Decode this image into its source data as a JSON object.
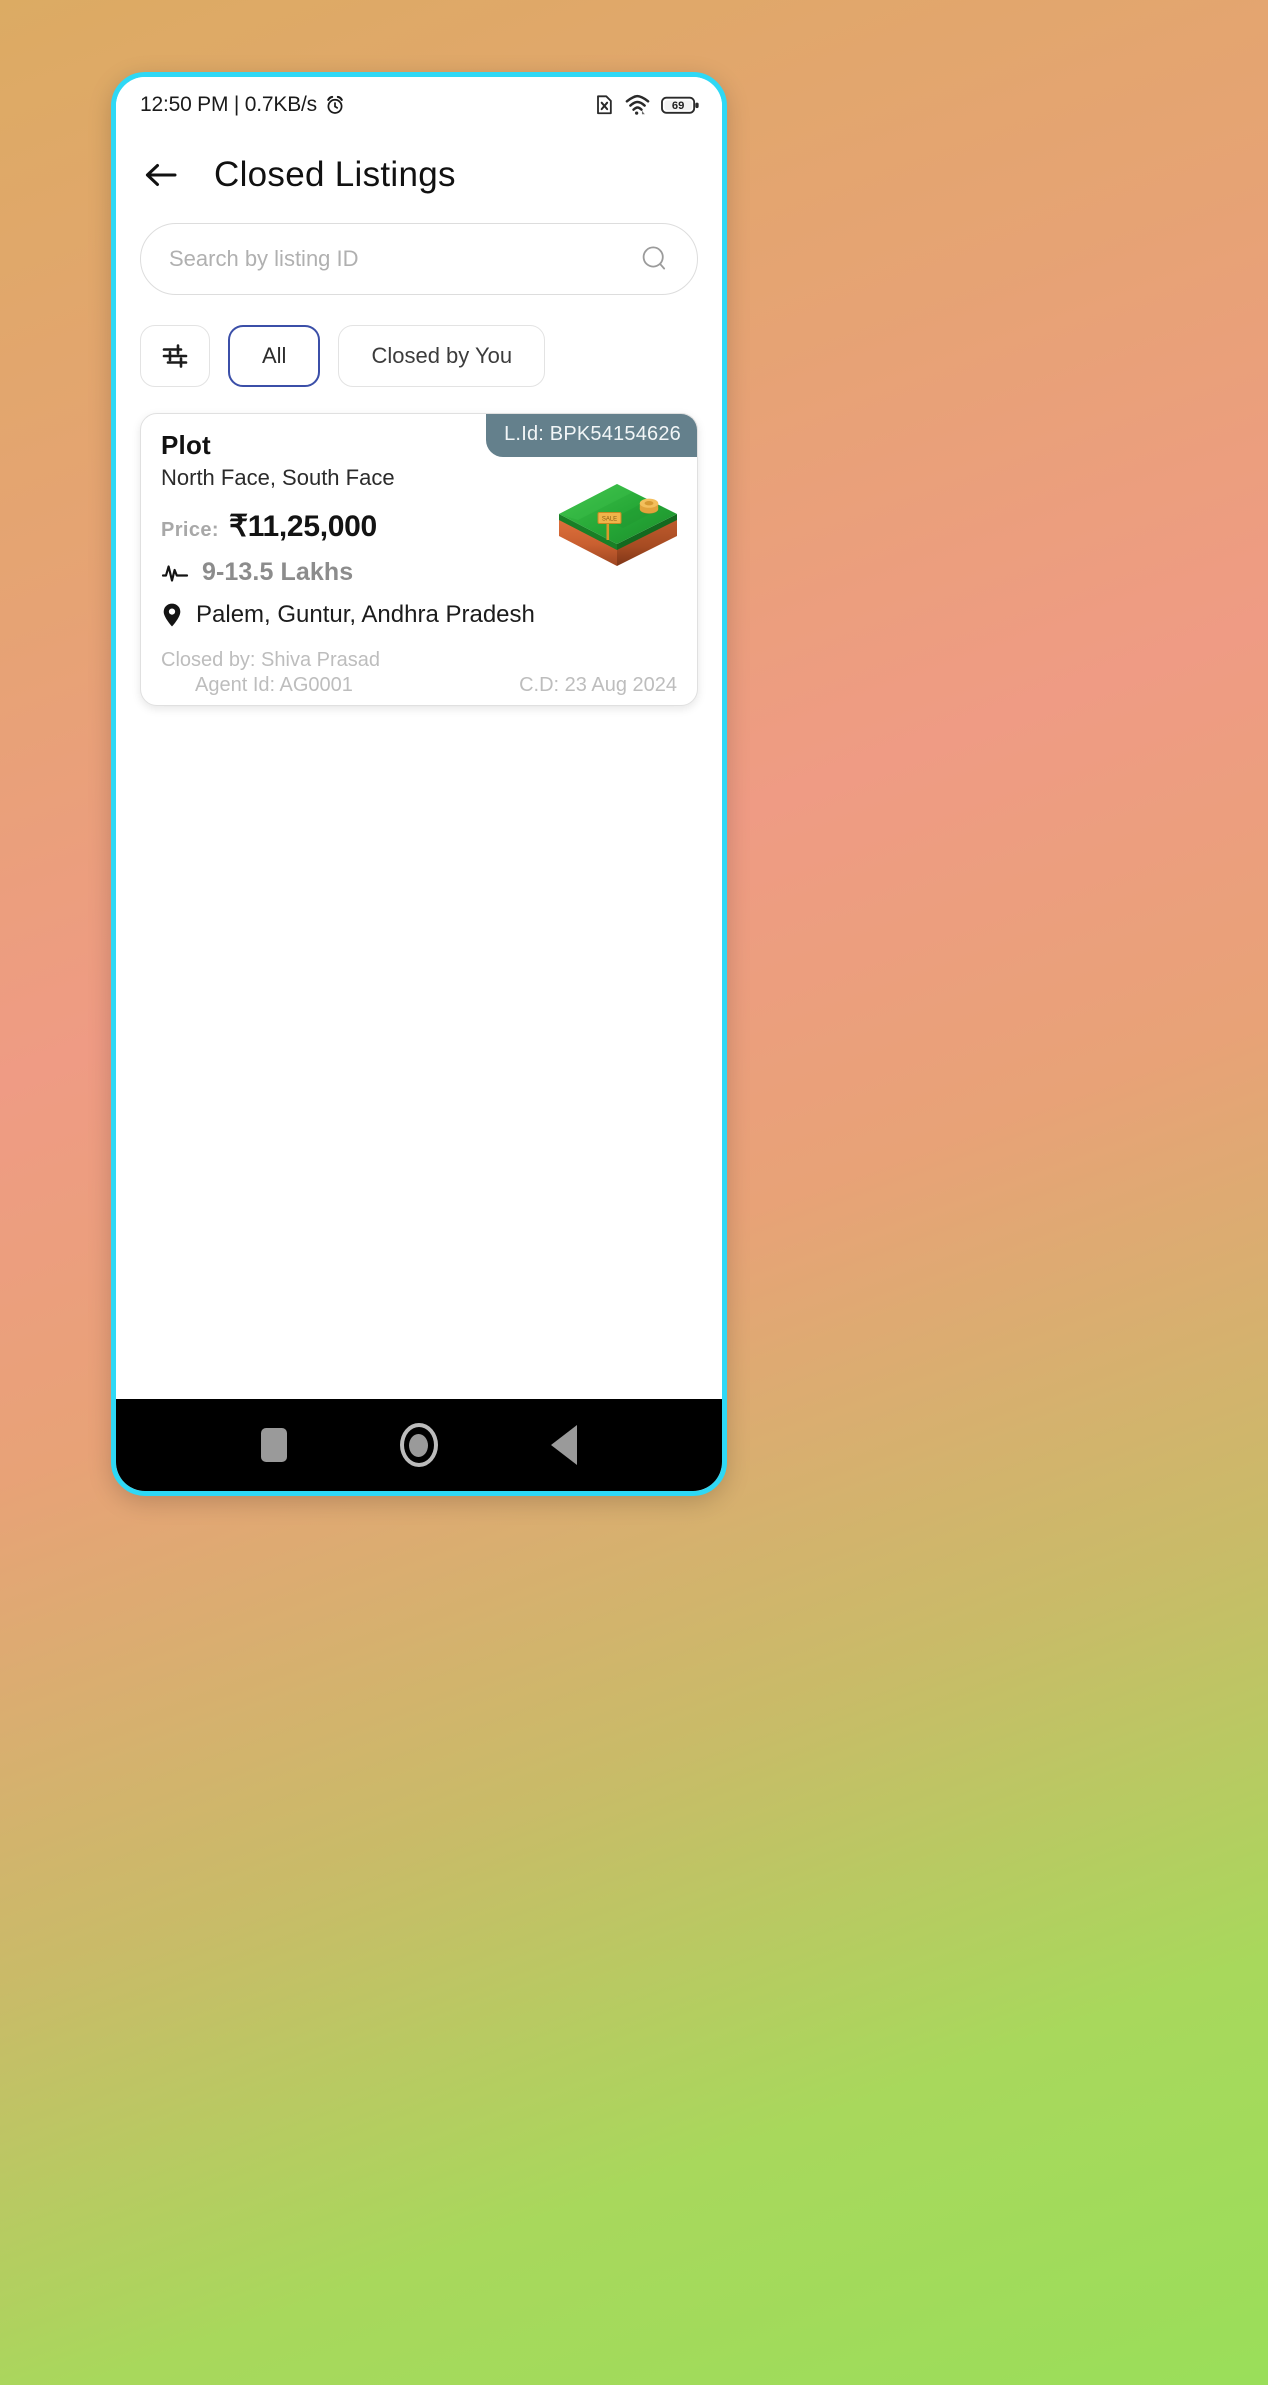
{
  "status_bar": {
    "time_and_speed": "12:50 PM | 0.7KB/s",
    "alarm_icon": "alarm-clock-icon",
    "sim_icon": "no-sim-icon",
    "wifi_icon": "wifi-icon",
    "battery_level": "69"
  },
  "app_bar": {
    "back_icon": "back-arrow-icon",
    "title": "Closed Listings"
  },
  "search": {
    "placeholder": "Search by listing ID",
    "value": "",
    "icon": "search-icon"
  },
  "filters": {
    "filter_icon": "tune-sliders-icon",
    "chips": [
      {
        "label": "All",
        "selected": true
      },
      {
        "label": "Closed by You",
        "selected": false
      }
    ],
    "selected_color": "#3b4fa8"
  },
  "listings": [
    {
      "listing_id_label": "L.Id: BPK54154626",
      "badge_color": "#64808c",
      "property_type": "Plot",
      "facing": "North Face, South Face",
      "price_label": "Price:",
      "price_value": "₹11,25,000",
      "range_icon": "activity-pulse-icon",
      "range_text": "9-13.5 Lakhs",
      "location_icon": "location-pin-icon",
      "location_text": "Palem, Guntur, Andhra Pradesh",
      "closed_by": "Closed by: Shiva Prasad",
      "agent_id": "Agent Id: AG0001",
      "closing_date": "C.D: 23 Aug 2024",
      "illustration": "plot-of-land-3d-icon"
    }
  ],
  "nav_bar": {
    "recents_icon": "recents-square-icon",
    "home_icon": "home-circle-icon",
    "back_icon": "back-triangle-icon"
  }
}
